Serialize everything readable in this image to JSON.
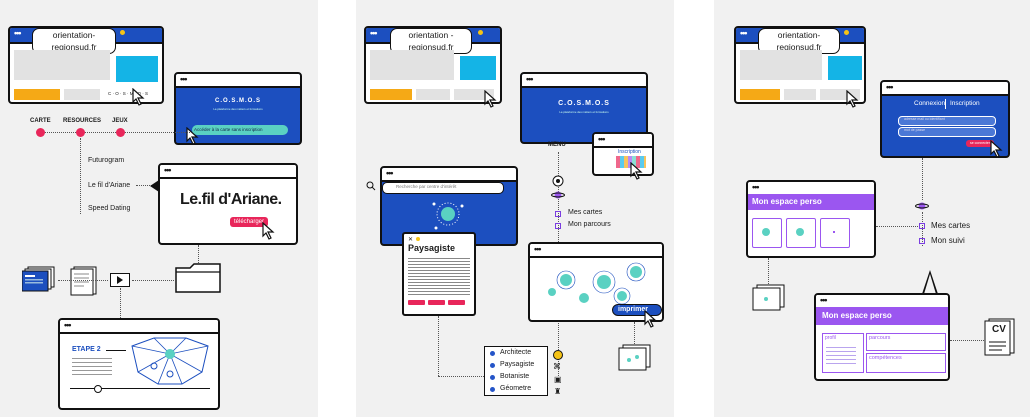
{
  "panel1": {
    "browser_url": "orientation-regionsud.fr",
    "cosmos_small": "C · O · S · M · O · S",
    "cosmos_title": "C.O.S.M.O.S",
    "cosmos_subtitle": "La plateforme des métiers et formations",
    "cta_label": "Accéder à la carte sans inscription",
    "nav": [
      "CARTE",
      "RESOURCES",
      "JEUX"
    ],
    "resources": [
      "Futurogram",
      "Le fil d'Ariane",
      "Speed Dating"
    ],
    "ariane_logo": "Le.fil d'Ariane.",
    "download_label": "télécharger",
    "etape_label": "ETAPE 2",
    "play_icon": "play-icon"
  },
  "panel2": {
    "browser_url": "orientation -regionsud.fr",
    "cosmos_title": "C.O.S.M.O.S",
    "cosmos_subtitle": "La plateforme des métiers et formations",
    "menu_label": "MENU",
    "inscription_label": "Inscription",
    "search_placeholder": "Recherche par centre d'intérêt",
    "job_title": "Paysagiste",
    "menu_items": [
      "Mes cartes",
      "Mon parcours"
    ],
    "print_label": "imprimer",
    "job_list": [
      "Architecte",
      "Paysagiste",
      "Botaniste",
      "Géometre"
    ]
  },
  "panel3": {
    "browser_url": "orientation-regionsud.fr",
    "auth_tabs": [
      "Connexion",
      "Inscription"
    ],
    "field_email": "adresse mail ou identifiant",
    "field_password": "mot de passe",
    "submit_label": "se connecter",
    "espace_title": "Mon espace perso",
    "menu_items": [
      "Mes cartes",
      "Mon suivi"
    ],
    "profile_box": "profil",
    "parcours_box": "parcours",
    "competences_box": "compétences",
    "cv_label": "CV"
  },
  "colors": {
    "blue": "#1c4fbf",
    "cyan": "#14b4e6",
    "orange": "#f5a916",
    "pink": "#e8265a",
    "purple": "#9b56f0",
    "teal": "#5ad1c2"
  }
}
